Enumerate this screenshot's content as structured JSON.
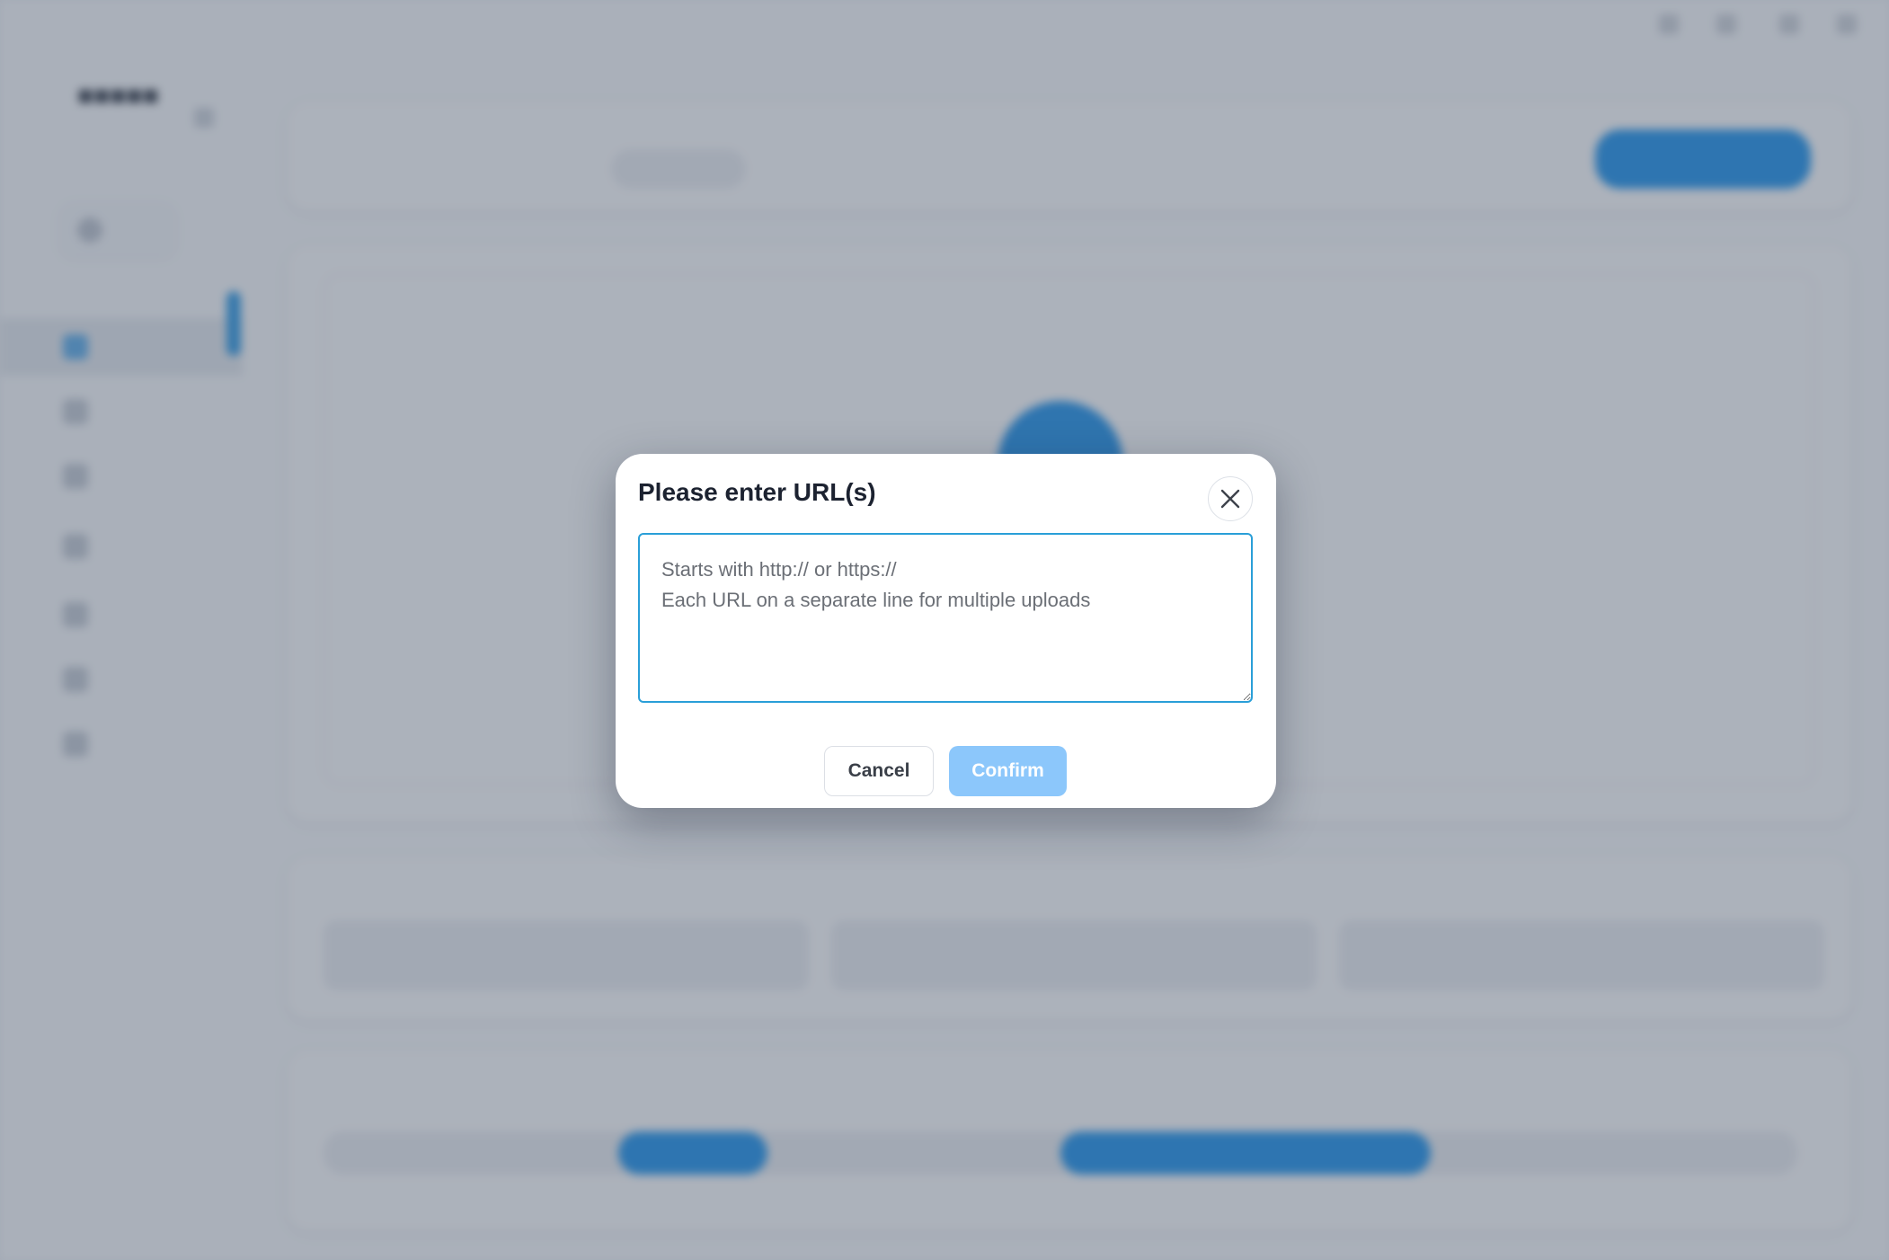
{
  "dialog": {
    "title": "Please enter URL(s)",
    "textarea_value": "",
    "textarea_placeholder": "Starts with http:// or https://\nEach URL on a separate line for multiple uploads",
    "cancel_label": "Cancel",
    "confirm_label": "Confirm"
  },
  "colors": {
    "accent": "#1e90e8",
    "confirm_disabled": "#8cc7fb",
    "focus_border": "#2a9fd8",
    "overlay": "rgba(70,80,100,0.42)"
  }
}
